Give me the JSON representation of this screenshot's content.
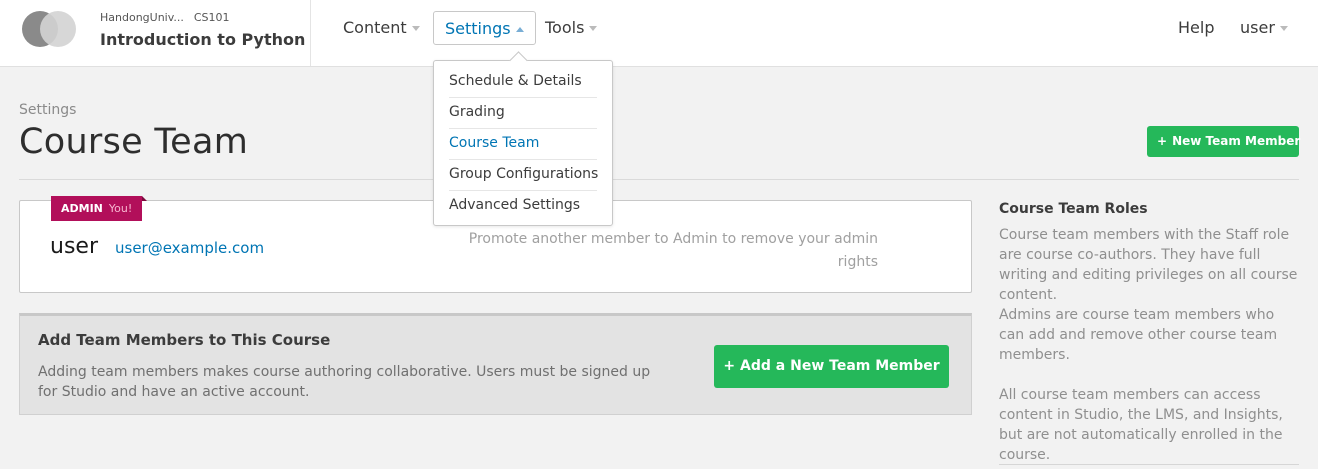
{
  "header": {
    "org": "HandongUniv...",
    "course_number": "CS101",
    "course_title": "Introduction to Python",
    "nav": {
      "content": "Content",
      "settings": "Settings",
      "tools": "Tools",
      "help": "Help",
      "user": "user"
    }
  },
  "settings_menu": {
    "items": [
      "Schedule & Details",
      "Grading",
      "Course Team",
      "Group Configurations",
      "Advanced Settings"
    ],
    "current": "Course Team"
  },
  "page": {
    "subtitle": "Settings",
    "title": "Course Team",
    "new_member_button": "New Team Member"
  },
  "member": {
    "role_badge": "ADMIN",
    "you_label": "You!",
    "name": "user",
    "email": "user@example.com",
    "note": "Promote another member to Admin to remove your admin rights"
  },
  "add_panel": {
    "title": "Add Team Members to This Course",
    "description": "Adding team members makes course authoring collaborative. Users must be signed up for Studio and have an active account.",
    "button": "Add a New Team Member"
  },
  "sidebar": {
    "title": "Course Team Roles",
    "paragraphs": [
      "Course team members with the Staff role are course co-authors. They have full writing and editing privileges on all course content.",
      "Admins are course team members who can add and remove other course team members.",
      "All course team members can access content in Studio, the LMS, and Insights, but are not automatically enrolled in the course."
    ]
  },
  "colors": {
    "accent_blue": "#0075b4",
    "button_green": "#25b85a",
    "admin_badge": "#b20f5a"
  }
}
